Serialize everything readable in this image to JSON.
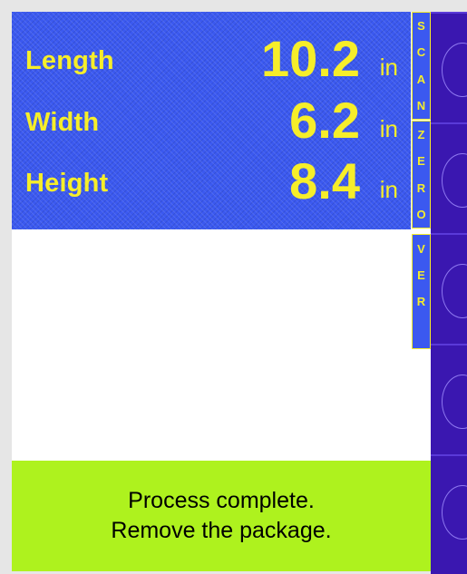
{
  "measurements": [
    {
      "label": "Length",
      "value": "10.2",
      "unit": "in"
    },
    {
      "label": "Width",
      "value": "6.2",
      "unit": "in"
    },
    {
      "label": "Height",
      "value": "8.4",
      "unit": "in"
    }
  ],
  "side_tabs": {
    "scan": [
      "S",
      "C",
      "A",
      "N"
    ],
    "zero": [
      "Z",
      "E",
      "R",
      "O"
    ],
    "ver": [
      "V",
      "E",
      "R"
    ]
  },
  "status": {
    "line1": "Process complete.",
    "line2": "Remove the package."
  },
  "softkey_icons": [
    "softkey-ring-icon",
    "softkey-ring-icon",
    "softkey-ring-icon",
    "softkey-ring-icon",
    "softkey-ring-icon"
  ],
  "colors": {
    "panel_blue": "#3b59f0",
    "text_yellow": "#f6ee2a",
    "status_green": "#aef21e",
    "softkey_purple": "#3a17b0"
  }
}
